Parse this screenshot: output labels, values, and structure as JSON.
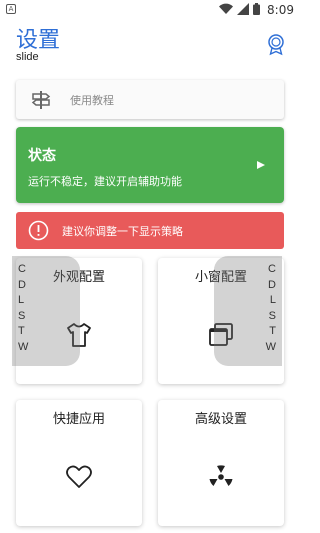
{
  "status_bar": {
    "app_badge": "A",
    "time": "8:09"
  },
  "header": {
    "title": "设置",
    "subtitle": "slide"
  },
  "search": {
    "placeholder": "使用教程"
  },
  "status_card": {
    "title": "状态",
    "description": "运行不稳定，建议开启辅助功能",
    "color": "#4cae50"
  },
  "warning": {
    "text": "建议你调整一下显示策略",
    "color": "#e85a5a"
  },
  "tiles": [
    {
      "label": "外观配置",
      "icon": "tshirt-icon"
    },
    {
      "label": "小窗配置",
      "icon": "windows-icon"
    },
    {
      "label": "快捷应用",
      "icon": "heart-icon"
    },
    {
      "label": "高级设置",
      "icon": "radiation-icon"
    }
  ],
  "side_left": {
    "letters": [
      "C",
      "D",
      "L",
      "S",
      "T",
      "W"
    ]
  },
  "side_right": {
    "letters": [
      "C",
      "D",
      "L",
      "S",
      "T",
      "W"
    ]
  },
  "colors": {
    "accent": "#2f6fd6"
  }
}
